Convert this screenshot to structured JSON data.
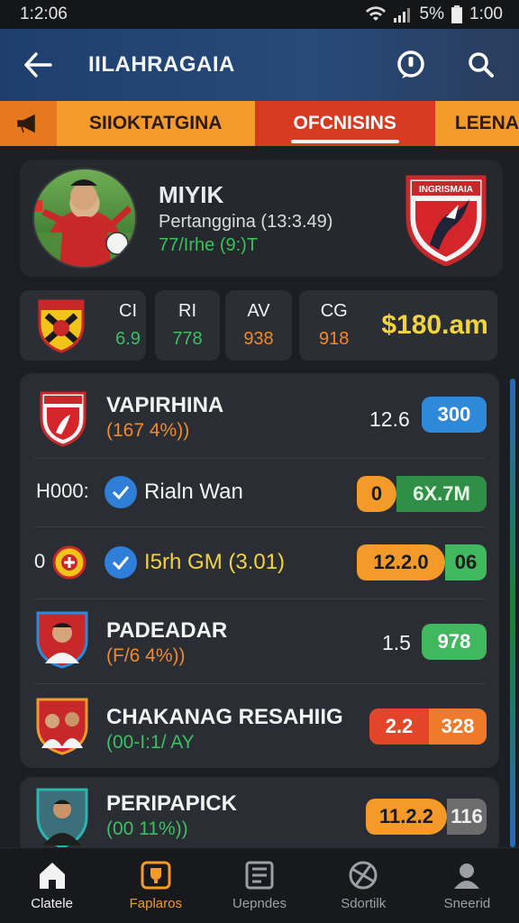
{
  "status": {
    "time": "1:2:06",
    "battery": "5%",
    "right_time": "1:00"
  },
  "appbar": {
    "title": "IILAHRAGAIA"
  },
  "tabs": [
    {
      "label": ""
    },
    {
      "label": "SIIOKTATGINA"
    },
    {
      "label": "OFCNISINS"
    },
    {
      "label": "LEENA"
    }
  ],
  "player": {
    "name": "MIYIK",
    "subtitle": "Pertanggina (13:3.49)",
    "detail": "77/Irhe (9:)T"
  },
  "crest": {
    "banner_text": "INGRISMAIA"
  },
  "stats": [
    {
      "label": "CI",
      "value": "6.9",
      "color": "#3fbf63"
    },
    {
      "label": "RI",
      "value": "778",
      "color": "#3fbf63"
    },
    {
      "label": "AV",
      "value": "938",
      "color": "#f08a2c"
    },
    {
      "label": "CG",
      "value": "918",
      "color": "#f08a2c"
    }
  ],
  "stats_money": "$180.am",
  "rows": [
    {
      "title": "VAPIRHINA",
      "subtitle": "(167 4%))",
      "sub_color": "#f08a2c",
      "odd": "12.6",
      "pill": [
        "300"
      ],
      "pill_colors": [
        "#2f89d9"
      ]
    },
    {
      "prefix": "H000:",
      "title": "Rialn Wan",
      "pill": [
        "0",
        "6X.7M"
      ],
      "pill_colors": [
        "#f39a2a",
        "#2f8f47"
      ]
    },
    {
      "prefix": "0",
      "title": "I5rh GM (3.01)",
      "pill": [
        "12.2.0",
        "06"
      ],
      "pill_colors": [
        "#f39a2a",
        "#3fb85e"
      ]
    },
    {
      "title": "PADEADAR",
      "subtitle": "(F/6 4%))",
      "sub_color": "#f08a2c",
      "odd": "1.5",
      "pill": [
        "978"
      ],
      "pill_colors": [
        "#3fb85e"
      ]
    },
    {
      "title": "CHAKANAG RESAHIIG",
      "subtitle": "(00-I:1/ AY",
      "sub_color": "#3fbf63",
      "pill": [
        "2.2",
        "328"
      ],
      "pill_colors": [
        "#e2452a",
        "#f07a2c"
      ]
    },
    {
      "title": "PERIPAPICK",
      "subtitle": "(00 11%))",
      "sub_color": "#3fbf63",
      "pill": [
        "11.2.2",
        "116"
      ],
      "pill_colors": [
        "#f39a2a",
        "#6c6c6c"
      ]
    }
  ],
  "nav": [
    {
      "label": "Clatele"
    },
    {
      "label": "Faplaros"
    },
    {
      "label": "Uepndes"
    },
    {
      "label": "Sdortilk"
    },
    {
      "label": "Sneerid"
    }
  ]
}
